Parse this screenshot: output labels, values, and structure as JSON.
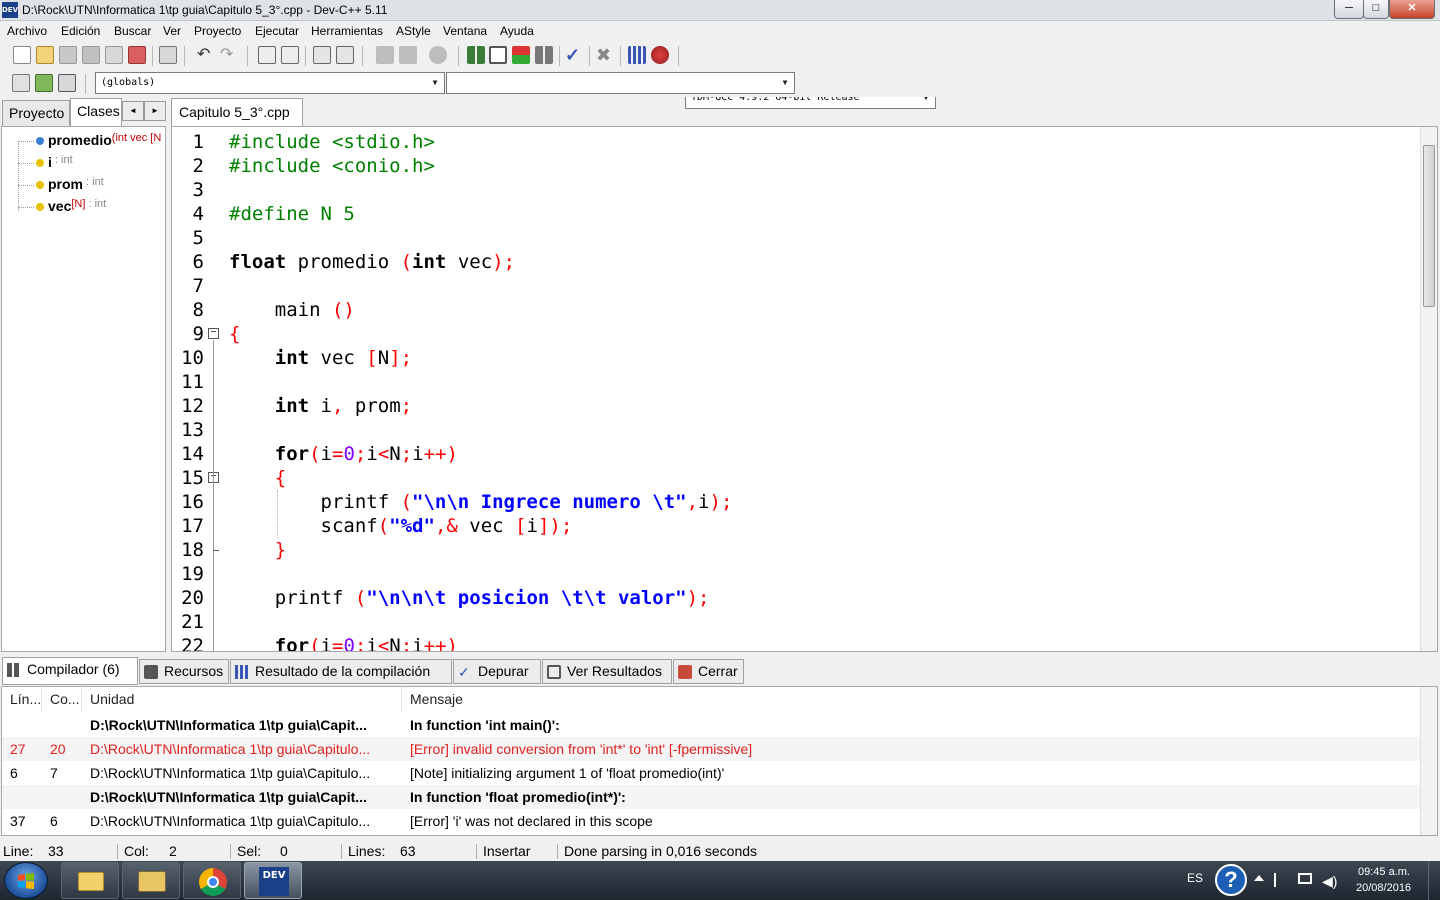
{
  "window": {
    "title": "D:\\Rock\\UTN\\Informatica 1\\tp guia\\Capitulo 5_3°.cpp - Dev-C++ 5.11",
    "app_icon_label": "DEV",
    "buttons": {
      "minimize": "─",
      "maximize": "□",
      "close": "✕"
    }
  },
  "menu": [
    "Archivo",
    "Edición",
    "Buscar",
    "Ver",
    "Proyecto",
    "Ejecutar",
    "Herramientas",
    "AStyle",
    "Ventana",
    "Ayuda"
  ],
  "toolbar": {
    "compiler_select": "TDM-GCC 4.9.2 64-bit Release",
    "scope_select": "(globals)",
    "member_select": ""
  },
  "left_panel": {
    "tabs": [
      "Proyecto",
      "Clases"
    ],
    "active_tab": "Clases",
    "nav_prev": "◄",
    "nav_next": "►",
    "tree": [
      {
        "name": "promedio",
        "detail": "(int vec [N",
        "kind": "function",
        "color": "#3a7fd0"
      },
      {
        "name": "i",
        "detail": " : int",
        "kind": "variable",
        "color": "#e8c200"
      },
      {
        "name": "prom",
        "detail": " : int",
        "kind": "variable",
        "color": "#e8c200"
      },
      {
        "name": "vec",
        "detail": "[N]",
        "detail2": " : int",
        "kind": "variable",
        "color": "#e8c200"
      }
    ]
  },
  "editor": {
    "tab": "Capitulo 5_3°.cpp",
    "line_numbers": [
      "1",
      "2",
      "3",
      "4",
      "5",
      "6",
      "7",
      "8",
      "9",
      "10",
      "11",
      "12",
      "13",
      "14",
      "15",
      "16",
      "17",
      "18",
      "19",
      "20",
      "21",
      "22"
    ],
    "lines": [
      [
        [
          "pp",
          "#include <stdio.h>"
        ]
      ],
      [
        [
          "pp",
          "#include <conio.h>"
        ]
      ],
      [],
      [
        [
          "pp",
          "#define N 5"
        ]
      ],
      [],
      [
        [
          "kw",
          "float"
        ],
        [
          "id",
          " promedio "
        ],
        [
          "sy",
          "("
        ],
        [
          "kw",
          "int"
        ],
        [
          "id",
          " vec"
        ],
        [
          "sy",
          ");"
        ]
      ],
      [],
      [
        [
          "id",
          "    main "
        ],
        [
          "sy",
          "()"
        ]
      ],
      [
        [
          "sy",
          "{"
        ]
      ],
      [
        [
          "id",
          "    "
        ],
        [
          "kw",
          "int"
        ],
        [
          "id",
          " vec "
        ],
        [
          "sy",
          "["
        ],
        [
          "id",
          "N"
        ],
        [
          "sy",
          "];"
        ]
      ],
      [],
      [
        [
          "id",
          "    "
        ],
        [
          "kw",
          "int"
        ],
        [
          "id",
          " i"
        ],
        [
          "sy",
          ","
        ],
        [
          "id",
          " prom"
        ],
        [
          "sy",
          ";"
        ]
      ],
      [],
      [
        [
          "id",
          "    "
        ],
        [
          "kw",
          "for"
        ],
        [
          "sy",
          "("
        ],
        [
          "id",
          "i"
        ],
        [
          "sy",
          "="
        ],
        [
          "nu",
          "0"
        ],
        [
          "sy",
          ";"
        ],
        [
          "id",
          "i"
        ],
        [
          "sy",
          "<"
        ],
        [
          "id",
          "N"
        ],
        [
          "sy",
          ";"
        ],
        [
          "id",
          "i"
        ],
        [
          "sy",
          "++)"
        ]
      ],
      [
        [
          "id",
          "    "
        ],
        [
          "sy",
          "{"
        ]
      ],
      [
        [
          "id",
          "        printf "
        ],
        [
          "sy",
          "("
        ],
        [
          "st",
          "\"\\n\\n Ingrece numero \\t\""
        ],
        [
          "sy",
          ","
        ],
        [
          "id",
          "i"
        ],
        [
          "sy",
          ");"
        ]
      ],
      [
        [
          "id",
          "        scanf"
        ],
        [
          "sy",
          "("
        ],
        [
          "st",
          "\"%d\""
        ],
        [
          "sy",
          ",&"
        ],
        [
          "id",
          " vec "
        ],
        [
          "sy",
          "["
        ],
        [
          "id",
          "i"
        ],
        [
          "sy",
          "]);"
        ]
      ],
      [
        [
          "id",
          "    "
        ],
        [
          "sy",
          "}"
        ]
      ],
      [],
      [
        [
          "id",
          "    printf "
        ],
        [
          "sy",
          "("
        ],
        [
          "st",
          "\"\\n\\n\\t posicion \\t\\t valor\""
        ],
        [
          "sy",
          ");"
        ]
      ],
      [],
      [
        [
          "id",
          "    "
        ],
        [
          "kw",
          "for"
        ],
        [
          "sy",
          "("
        ],
        [
          "id",
          "i"
        ],
        [
          "sy",
          "="
        ],
        [
          "nu",
          "0"
        ],
        [
          "sy",
          ";"
        ],
        [
          "id",
          "i"
        ],
        [
          "sy",
          "<"
        ],
        [
          "id",
          "N"
        ],
        [
          "sy",
          ";"
        ],
        [
          "id",
          "i"
        ],
        [
          "sy",
          "++)"
        ]
      ]
    ]
  },
  "bottom_tabs": [
    {
      "label": "Compilador (6)",
      "icon": "grid-icon",
      "active": true
    },
    {
      "label": "Recursos",
      "icon": "resources-icon",
      "active": false
    },
    {
      "label": "Resultado de la compilación",
      "icon": "bar-chart-icon",
      "active": false
    },
    {
      "label": "Depurar",
      "icon": "check-icon",
      "active": false
    },
    {
      "label": "Ver Resultados",
      "icon": "search-icon",
      "active": false
    },
    {
      "label": "Cerrar",
      "icon": "close-icon",
      "active": false
    }
  ],
  "messages": {
    "headers": [
      "Lín...",
      "Co...",
      "Unidad",
      "Mensaje"
    ],
    "rows": [
      {
        "line": "",
        "col": "",
        "unit": "D:\\Rock\\UTN\\Informatica 1\\tp guia\\Capit...",
        "message": "In function 'int main()':",
        "style": "bold"
      },
      {
        "line": "27",
        "col": "20",
        "unit": "D:\\Rock\\UTN\\Informatica 1\\tp guia\\Capitulo...",
        "message": "[Error] invalid conversion from 'int*' to 'int' [-fpermissive]",
        "style": "err"
      },
      {
        "line": "6",
        "col": "7",
        "unit": "D:\\Rock\\UTN\\Informatica 1\\tp guia\\Capitulo...",
        "message": "[Note] initializing argument 1 of 'float promedio(int)'",
        "style": "normal"
      },
      {
        "line": "",
        "col": "",
        "unit": "D:\\Rock\\UTN\\Informatica 1\\tp guia\\Capit...",
        "message": "In function 'float promedio(int*)':",
        "style": "bold"
      },
      {
        "line": "37",
        "col": "6",
        "unit": "D:\\Rock\\UTN\\Informatica 1\\tp guia\\Capitulo...",
        "message": "[Error] 'i' was not declared in this scope",
        "style": "normal"
      }
    ]
  },
  "status": {
    "line_label": "Line:",
    "line_value": "33",
    "col_label": "Col:",
    "col_value": "2",
    "sel_label": "Sel:",
    "sel_value": "0",
    "lines_label": "Lines:",
    "lines_value": "63",
    "mode": "Insertar",
    "message": "Done parsing in 0,016 seconds"
  },
  "taskbar": {
    "lang": "ES",
    "help": "?",
    "time": "09:45 a.m.",
    "date": "20/08/2016",
    "dev_label": "DEV"
  }
}
